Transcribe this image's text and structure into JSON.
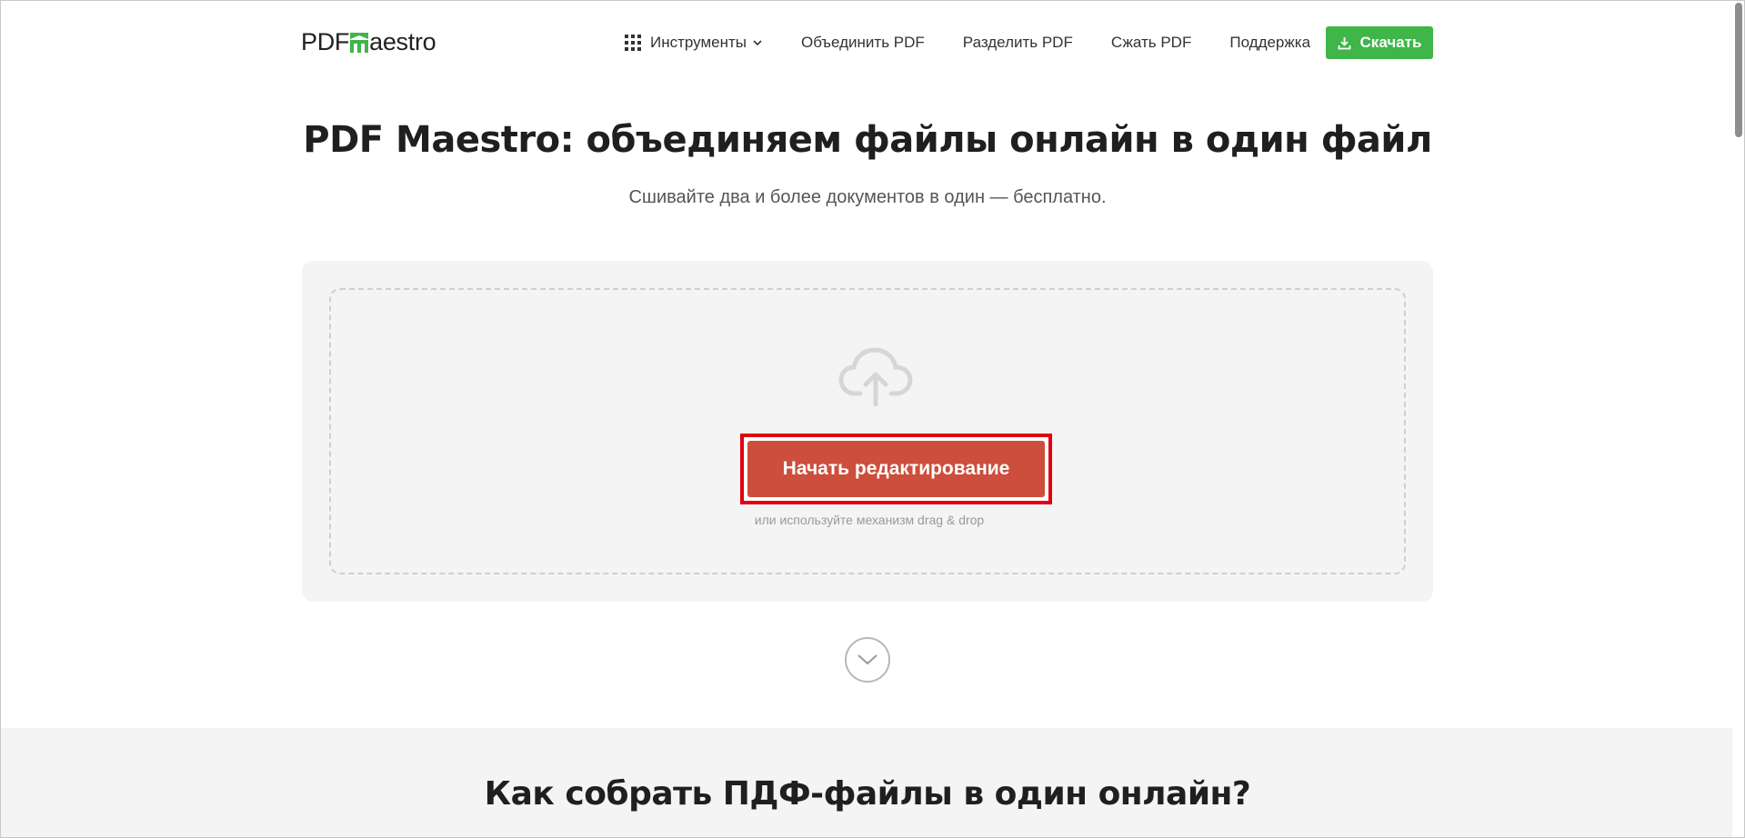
{
  "header": {
    "logo": {
      "part1": "PDF",
      "part2": "aestro"
    },
    "nav": {
      "tools_label": "Инструменты",
      "links": [
        "Объединить PDF",
        "Разделить PDF",
        "Сжать PDF",
        "Поддержка"
      ]
    },
    "download_label": "Скачать"
  },
  "hero": {
    "title": "PDF Maestro: объединяем файлы онлайн в один файл",
    "subtitle": "Сшивайте два и более документов в один — бесплатно."
  },
  "upload": {
    "start_label": "Начать редактирование",
    "hint": "или используйте механизм drag & drop"
  },
  "howto": {
    "title": "Как собрать ПДФ-файлы в один онлайн?"
  },
  "colors": {
    "accent_green": "#3fb54a",
    "start_button": "#cd4e3c",
    "highlight_border": "#e0000f"
  },
  "icons": [
    "grid-icon",
    "chevron-down-icon",
    "download-icon",
    "cloud-upload-icon",
    "scroll-down-icon"
  ]
}
